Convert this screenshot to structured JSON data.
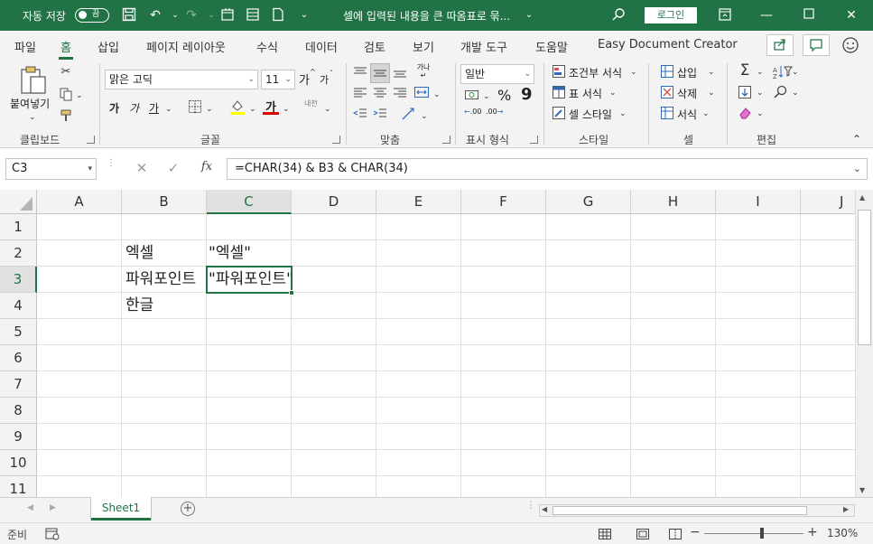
{
  "titlebar": {
    "autosave_label": "자동 저장",
    "autosave_state": "끔",
    "doc_title": "셀에 입력된 내용을 큰 따옴표로 묶...",
    "login_label": "로그인"
  },
  "menu": {
    "tabs": [
      "파일",
      "홈",
      "삽입",
      "페이지 레이아웃",
      "수식",
      "데이터",
      "검토",
      "보기",
      "개발 도구",
      "도움말",
      "Easy Document Creator"
    ],
    "active": "홈"
  },
  "ribbon": {
    "clipboard": {
      "paste_label": "붙여넣기",
      "group": "클립보드"
    },
    "font": {
      "name": "맑은 고딕",
      "size": "11",
      "bold": "가",
      "italic": "가",
      "underline": "가",
      "group": "글꼴",
      "grow": "가",
      "shrink": "가",
      "phonetic": "내천"
    },
    "alignment": {
      "group": "맞춤",
      "wrap": "가나"
    },
    "number": {
      "format": "일반",
      "percent": "%",
      "comma": "9",
      "group": "표시 형식",
      "increase_decimal": ".00",
      "decrease_decimal": ".00"
    },
    "styles": {
      "conditional": "조건부 서식",
      "table": "표 서식",
      "cell": "셀 스타일",
      "group": "스타일"
    },
    "cells": {
      "insert": "삽입",
      "delete": "삭제",
      "format": "서식",
      "group": "셀"
    },
    "editing": {
      "group": "편집"
    }
  },
  "formula": {
    "namebox": "C3",
    "content": "=CHAR(34) & B3 & CHAR(34)"
  },
  "sheet": {
    "columns": [
      "A",
      "B",
      "C",
      "D",
      "E",
      "F",
      "G",
      "H",
      "I",
      "J"
    ],
    "rows": [
      "1",
      "2",
      "3",
      "4",
      "5",
      "6",
      "7",
      "8",
      "9",
      "10",
      "11"
    ],
    "selected_col": "C",
    "selected_row": "3",
    "cells": {
      "B2": "엑셀",
      "C2": "\"엑셀\"",
      "B3": "파워포인트",
      "C3": "\"파워포인트\"",
      "B4": "한글"
    }
  },
  "tabs": {
    "sheet1": "Sheet1"
  },
  "status": {
    "ready": "준비",
    "zoom": "130%"
  },
  "colors": {
    "accent": "#217346"
  }
}
